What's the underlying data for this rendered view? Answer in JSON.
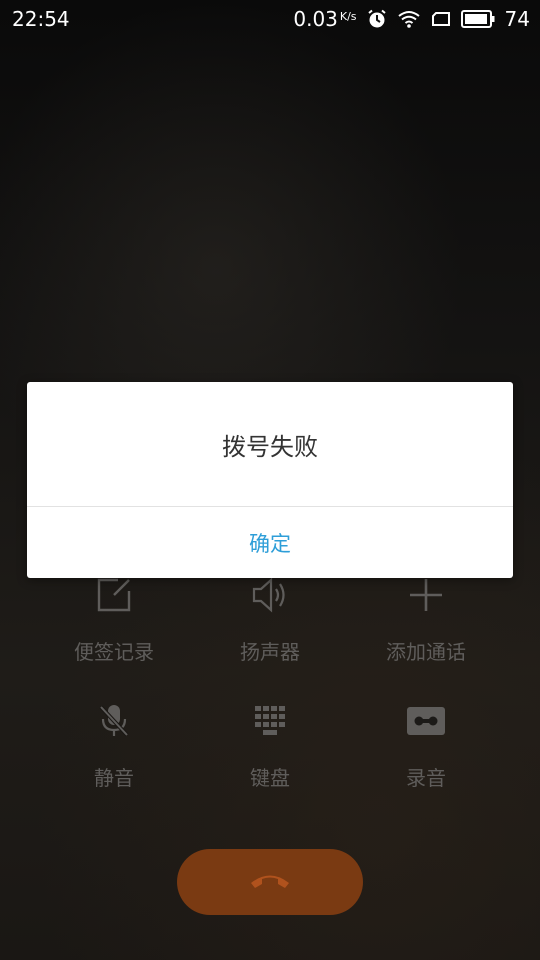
{
  "status_bar": {
    "time": "22:54",
    "network_speed": "0.03",
    "network_speed_unit": "K/s",
    "battery_level": "74",
    "icons": [
      "alarm-icon",
      "wifi-icon",
      "screen-rotation-icon",
      "battery-icon"
    ]
  },
  "call": {
    "controls": [
      {
        "label": "便签记录",
        "icon": "note-edit-icon"
      },
      {
        "label": "扬声器",
        "icon": "speaker-icon"
      },
      {
        "label": "添加通话",
        "icon": "add-call-icon"
      },
      {
        "label": "静音",
        "icon": "mute-mic-icon"
      },
      {
        "label": "键盘",
        "icon": "keypad-icon"
      },
      {
        "label": "录音",
        "icon": "record-icon"
      }
    ],
    "hangup_icon": "hangup-icon"
  },
  "dialog": {
    "message": "拨号失败",
    "confirm_label": "确定"
  },
  "colors": {
    "dialog_button": "#2e9ed8",
    "hangup": "#7a3a12",
    "control_gray": "#5f5d5b"
  }
}
